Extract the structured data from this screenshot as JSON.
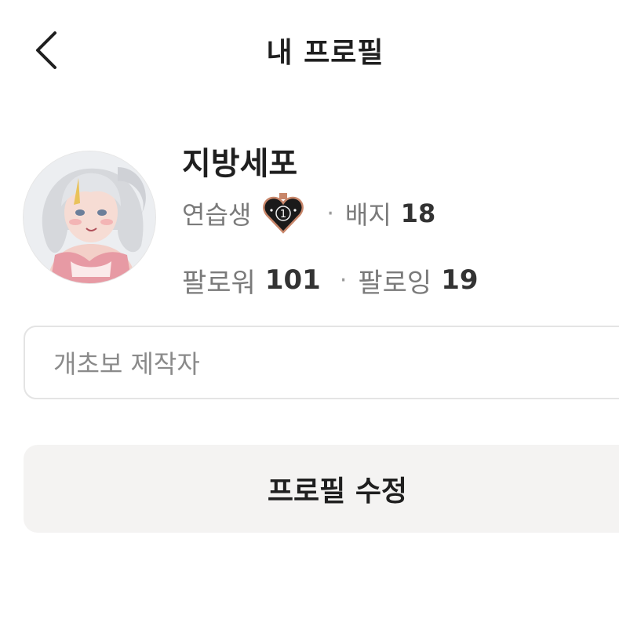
{
  "header": {
    "title": "내 프로필",
    "back_icon": "chevron-left-icon"
  },
  "profile": {
    "nickname": "지방세포",
    "rank_label": "연습생",
    "rank_badge": {
      "icon": "heart-rank-badge-icon",
      "number": "1",
      "fill": "#1a1a1a",
      "accent": "#c8866a"
    },
    "separator": "·",
    "badge_label": "배지",
    "badge_count": "18",
    "followers_label": "팔로워",
    "followers_count": "101",
    "following_label": "팔로잉",
    "following_count": "19"
  },
  "bio": {
    "value": "개초보 제작자"
  },
  "edit_button": {
    "label": "프로필 수정"
  },
  "tabs": [
    {
      "label": ""
    },
    {
      "label": ""
    }
  ],
  "colors": {
    "text_primary": "#1f1f1f",
    "text_secondary": "#7a7a7a",
    "button_bg": "#f4f3f2",
    "border": "#e4e4e4"
  }
}
